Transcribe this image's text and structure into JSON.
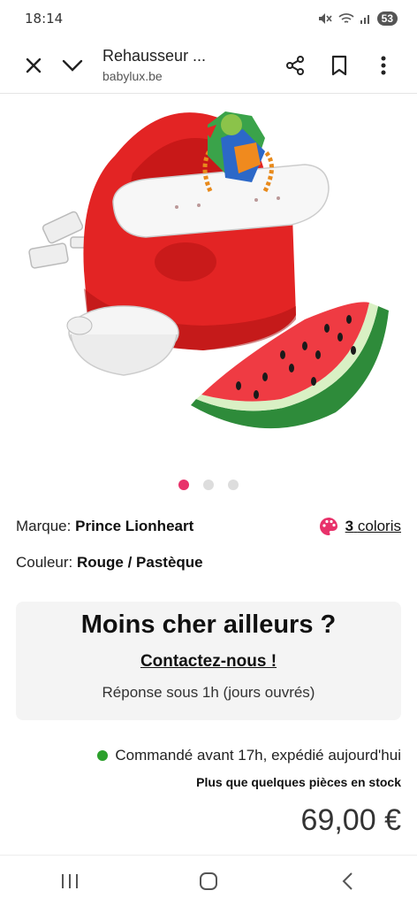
{
  "status_bar": {
    "time": "18:14",
    "battery": "53"
  },
  "browser": {
    "title": "Rehausseur ...",
    "domain": "babylux.be"
  },
  "product": {
    "brand_label": "Marque:",
    "brand": "Prince Lionheart",
    "colors_count": "3",
    "colors_suffix": "coloris",
    "color_label": "Couleur:",
    "color": "Rouge / Pastèque"
  },
  "carousel": {
    "active_index": 0,
    "count": 3
  },
  "cheaper_box": {
    "title": "Moins cher ailleurs ?",
    "link": "Contactez-nous !",
    "subtitle": "Réponse sous 1h (jours ouvrés)"
  },
  "shipping": {
    "text": "Commandé avant 17h, expédié aujourd'hui",
    "stock": "Plus que quelques pièces en stock"
  },
  "price": "69,00 €",
  "colors": {
    "accent": "#e8316a",
    "in_stock": "#2ca02c"
  }
}
